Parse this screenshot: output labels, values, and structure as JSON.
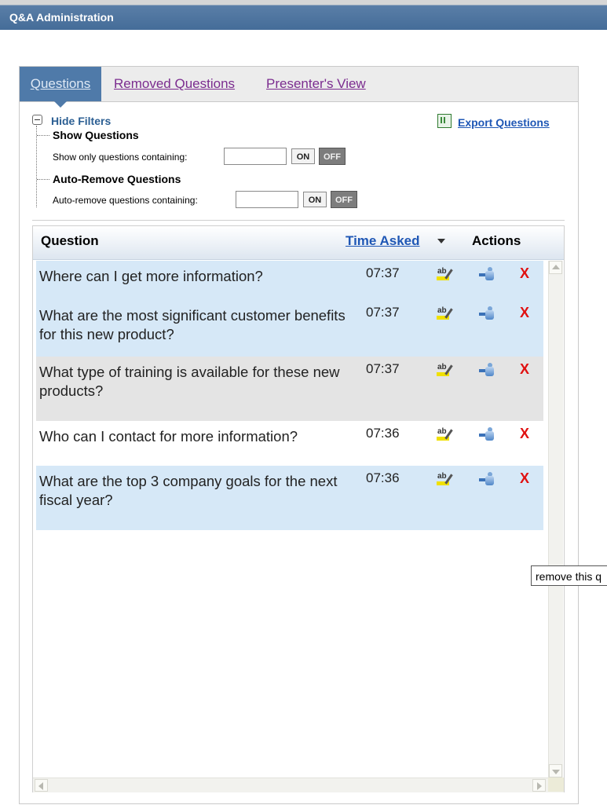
{
  "window": {
    "title": "Q&A Administration"
  },
  "tabs": [
    {
      "label": "Questions",
      "active": true
    },
    {
      "label": "Removed Questions",
      "active": false
    },
    {
      "label": "Presenter's View",
      "active": false
    }
  ],
  "filters": {
    "toggle_label": "Hide Filters",
    "show_section_title": "Show Questions",
    "show_label": "Show only questions containing:",
    "show_value": "",
    "auto_section_title": "Auto-Remove Questions",
    "auto_label": "Auto-remove questions containing:",
    "auto_value": "",
    "on_label": "ON",
    "off_label": "OFF"
  },
  "export": {
    "label": "Export Questions"
  },
  "table": {
    "columns": {
      "question": "Question",
      "time": "Time Asked",
      "actions": "Actions"
    },
    "rows": [
      {
        "question": "Where can I get more information?",
        "time": "07:37",
        "bg": "#d6e8f7"
      },
      {
        "question": "What are the most significant customer benefits for this new product?",
        "time": "07:37",
        "bg": "#d6e8f7"
      },
      {
        "question": "What type of training is available for these new products?",
        "time": "07:37",
        "bg": "#e4e4e4"
      },
      {
        "question": "Who can I contact for more information?",
        "time": "07:36",
        "bg": "#ffffff"
      },
      {
        "question": "What are the top 3 company goals for the next fiscal year?",
        "time": "07:36",
        "bg": "#d6e8f7"
      }
    ],
    "remove_glyph": "X"
  },
  "tooltip": {
    "text": "remove this q"
  },
  "colors": {
    "header_bar": "#456d99",
    "link": "#1f57b5",
    "visited_tab": "#7b2c8f",
    "remove": "#e01010",
    "row_highlight": "#d6e8f7"
  }
}
